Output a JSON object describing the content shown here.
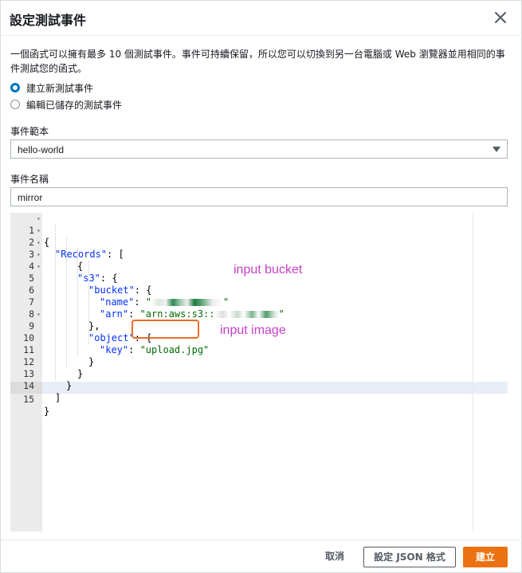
{
  "dialog": {
    "title": "設定測試事件",
    "description": "一個函式可以擁有最多 10 個測試事件。事件可持續保留，所以您可以切換到另一台電腦或 Web 瀏覽器並用相同的事件測試您的函式。"
  },
  "options": {
    "create_new": "建立新測試事件",
    "edit_saved": "編輯已儲存的測試事件",
    "selected": "create_new"
  },
  "template": {
    "label": "事件範本",
    "value": "hello-world"
  },
  "event_name": {
    "label": "事件名稱",
    "value": "mirror"
  },
  "editor": {
    "line_numbers": [
      "1",
      "2",
      "3",
      "4",
      "5",
      "6",
      "7",
      "8",
      "9",
      "10",
      "11",
      "12",
      "13",
      "14",
      "15"
    ],
    "l1": "{",
    "l2_key": "\"Records\"",
    "l2_rest": ": [",
    "l3": "{",
    "l4_key": "\"s3\"",
    "l4_rest": ": {",
    "l5_key": "\"bucket\"",
    "l5_rest": ": {",
    "l6_key": "\"name\"",
    "l6_sep": ": ",
    "l6_val": "\"",
    "l6_tail": "\"",
    "l7_key": "\"arn\"",
    "l7_sep": ": ",
    "l7_val": "\"arn:aws:s3::",
    "l7_tail": "\"",
    "l8": "},",
    "l9_key": "\"object\"",
    "l9_rest": ": {",
    "l10_key": "\"key\"",
    "l10_sep": ": ",
    "l10_val": "\"upload.jpg\"",
    "l11": "}",
    "l12": "}",
    "l13": "}",
    "l14": "]",
    "l15": "}"
  },
  "annotations": {
    "bucket_note": "input bucket",
    "image_note": "input image"
  },
  "footer": {
    "cancel": "取消",
    "format": "設定 JSON 格式",
    "create": "建立"
  },
  "colors": {
    "primary_button": "#ec7211",
    "radio_selected": "#0073bb",
    "annotation": "#c440c8",
    "highlight_box": "#ee6b28"
  }
}
